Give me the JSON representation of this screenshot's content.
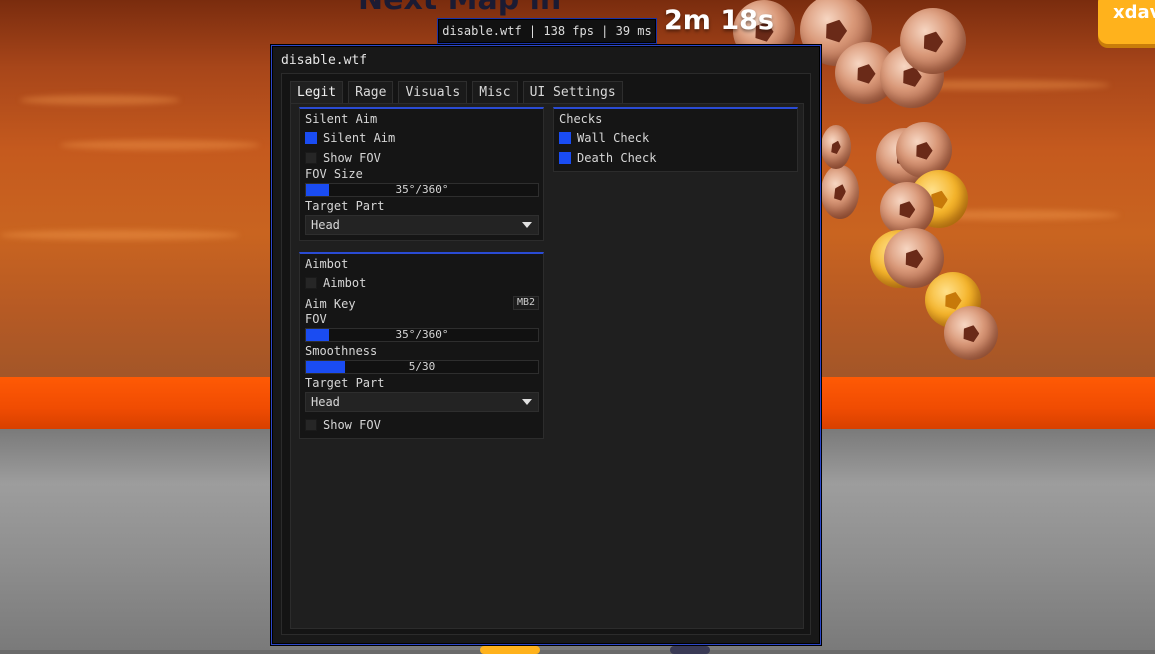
{
  "hud": {
    "watermark": "disable.wtf | 138 fps | 39 ms",
    "timer": "2m 18s",
    "corner_button_label": "xdav",
    "partial_top_text": "Next Map in"
  },
  "menu": {
    "title": "disable.wtf",
    "tabs": [
      {
        "label": "Legit",
        "active": true
      },
      {
        "label": "Rage",
        "active": false
      },
      {
        "label": "Visuals",
        "active": false
      },
      {
        "label": "Misc",
        "active": false
      },
      {
        "label": "UI Settings",
        "active": false
      }
    ],
    "accent_color": "#1a4cf2",
    "silent_aim": {
      "title": "Silent Aim",
      "silent_aim_checkbox": {
        "label": "Silent Aim",
        "checked": true
      },
      "show_fov_checkbox": {
        "label": "Show FOV",
        "checked": false
      },
      "fov_size": {
        "label": "FOV Size",
        "value_text": "35°/360°",
        "fraction": 0.097
      },
      "target_part": {
        "label": "Target Part",
        "value": "Head"
      }
    },
    "aimbot": {
      "title": "Aimbot",
      "aimbot_checkbox": {
        "label": "Aimbot",
        "checked": false
      },
      "aim_key": {
        "label": "Aim Key",
        "bind": "MB2"
      },
      "fov": {
        "label": "FOV",
        "value_text": "35°/360°",
        "fraction": 0.097
      },
      "smoothness": {
        "label": "Smoothness",
        "value_text": "5/30",
        "fraction": 0.167
      },
      "target_part": {
        "label": "Target Part",
        "value": "Head"
      },
      "show_fov_checkbox": {
        "label": "Show FOV",
        "checked": false
      }
    },
    "checks": {
      "title": "Checks",
      "wall_check": {
        "label": "Wall Check",
        "checked": true
      },
      "death_check": {
        "label": "Death Check",
        "checked": true
      }
    }
  }
}
